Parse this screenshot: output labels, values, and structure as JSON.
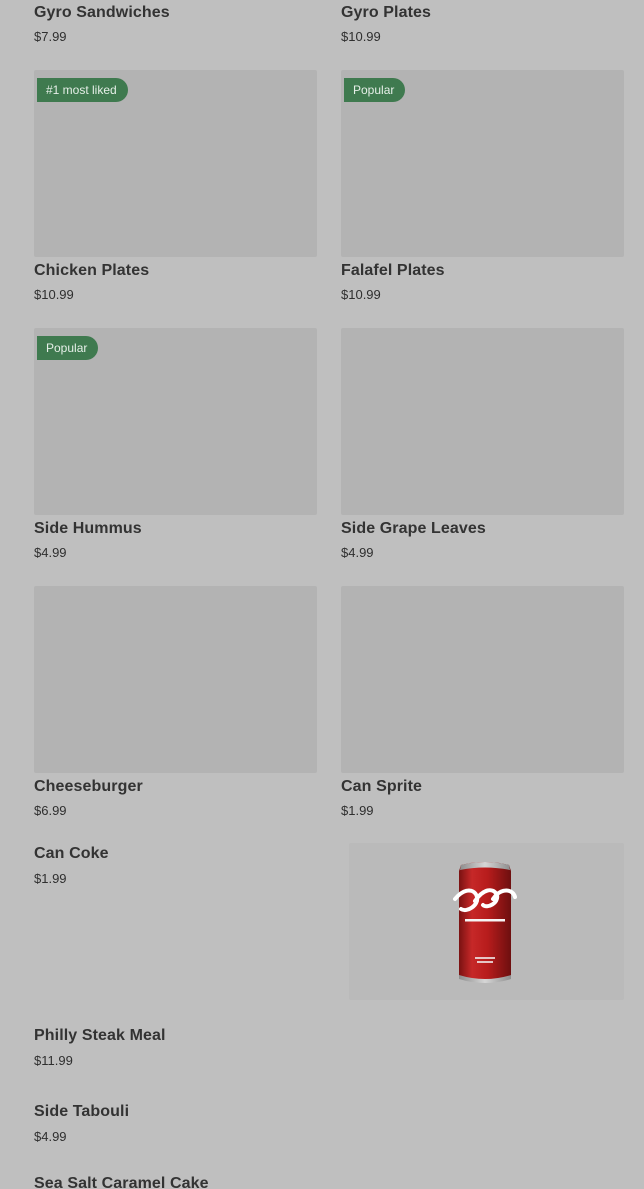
{
  "colors": {
    "background": "#bfbfbf",
    "image_placeholder": "#b3b3b3",
    "badge_bg": "#3f7a4f",
    "badge_text": "#e6efe8"
  },
  "menu": {
    "items": [
      {
        "name": "Gyro Sandwiches",
        "price": "$7.99"
      },
      {
        "name": "Gyro Plates",
        "price": "$10.99"
      },
      {
        "name": "Chicken Plates",
        "price": "$10.99",
        "badge": "#1 most liked"
      },
      {
        "name": "Falafel Plates",
        "price": "$10.99",
        "badge": "Popular"
      },
      {
        "name": "Side Hummus",
        "price": "$4.99",
        "badge": "Popular"
      },
      {
        "name": "Side Grape Leaves",
        "price": "$4.99"
      },
      {
        "name": "Cheeseburger",
        "price": "$6.99"
      },
      {
        "name": "Can Sprite",
        "price": "$1.99"
      },
      {
        "name": "Can Coke",
        "price": "$1.99",
        "image_icon": "coke-can-icon"
      },
      {
        "name": "Philly Steak Meal",
        "price": "$11.99"
      },
      {
        "name": "Side Tabouli",
        "price": "$4.99"
      },
      {
        "name": "Sea Salt Caramel Cake"
      }
    ]
  }
}
